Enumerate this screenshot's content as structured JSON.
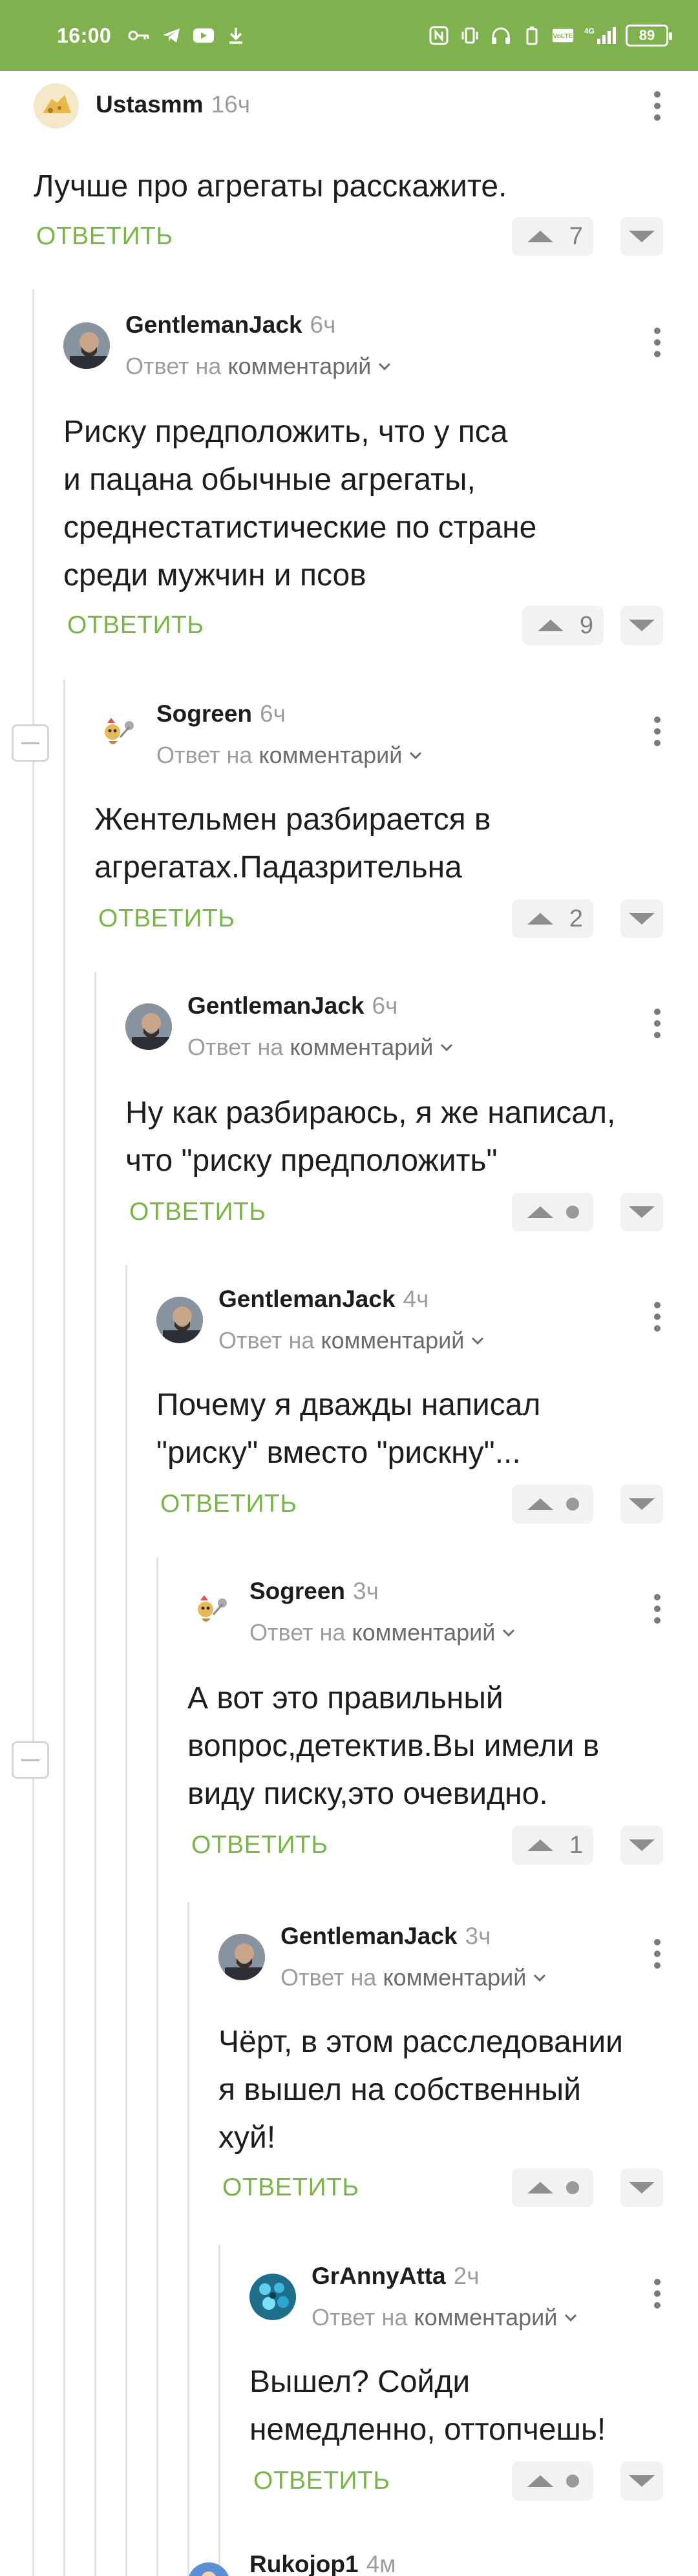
{
  "status_bar": {
    "time": "16:00",
    "battery": "89",
    "left_icons": [
      "key-icon",
      "telegram-icon",
      "youtube-icon",
      "download-icon"
    ],
    "right_icons": [
      "nfc-icon",
      "vibrate-icon",
      "headphones-icon",
      "battery-saver-icon",
      "volte-icon",
      "signal-icon"
    ],
    "net_label": "4G"
  },
  "reply_to_label": "Ответ на",
  "reply_to_link": "комментарий",
  "reply_button_label": "ОТВЕТИТЬ",
  "colors": {
    "accent": "#79b547",
    "status_bar": "#7fb24f"
  },
  "comments": [
    {
      "author": "Ustasmm",
      "time": "16ч",
      "text": "Лучше про агрегаты расскажите.",
      "rating": "7",
      "level": 0
    },
    {
      "author": "GentlemanJack",
      "time": "6ч",
      "text": "Риску предположить, что у пса\nи пацана обычные агрегаты,\nсреднестатистические по стране\nсреди мужчин и псов",
      "rating": "9",
      "level": 1
    },
    {
      "author": "Sogreen",
      "time": "6ч",
      "text": "Жентельмен разбирается в\nагрегатах.Падазрительна",
      "rating": "2",
      "level": 2
    },
    {
      "author": "GentlemanJack",
      "time": "6ч",
      "text": "Ну как разбираюсь, я же написал,\nчто \"риску предположить\"",
      "rating": "",
      "level": 3
    },
    {
      "author": "GentlemanJack",
      "time": "4ч",
      "text": "Почему я дважды написал\n\"риску\" вместо \"рискну\"...",
      "rating": "",
      "level": 4
    },
    {
      "author": "Sogreen",
      "time": "3ч",
      "text": "А вот это правильный\nвопрос,детектив.Вы имели в\nвиду писку,это очевидно.",
      "rating": "1",
      "level": 5
    },
    {
      "author": "GentlemanJack",
      "time": "3ч",
      "text": "Чёрт, в этом расследовании\nя вышел на собственный\nхуй!",
      "rating": "",
      "level": 6
    },
    {
      "author": "GrAnnyAtta",
      "time": "2ч",
      "text": "Вышел? Сойди\nнемедленно, оттопчешь!",
      "rating": "",
      "level": 7
    },
    {
      "author": "Rukojop1",
      "time": "4м",
      "text": "",
      "rating": "",
      "level": 8
    }
  ]
}
